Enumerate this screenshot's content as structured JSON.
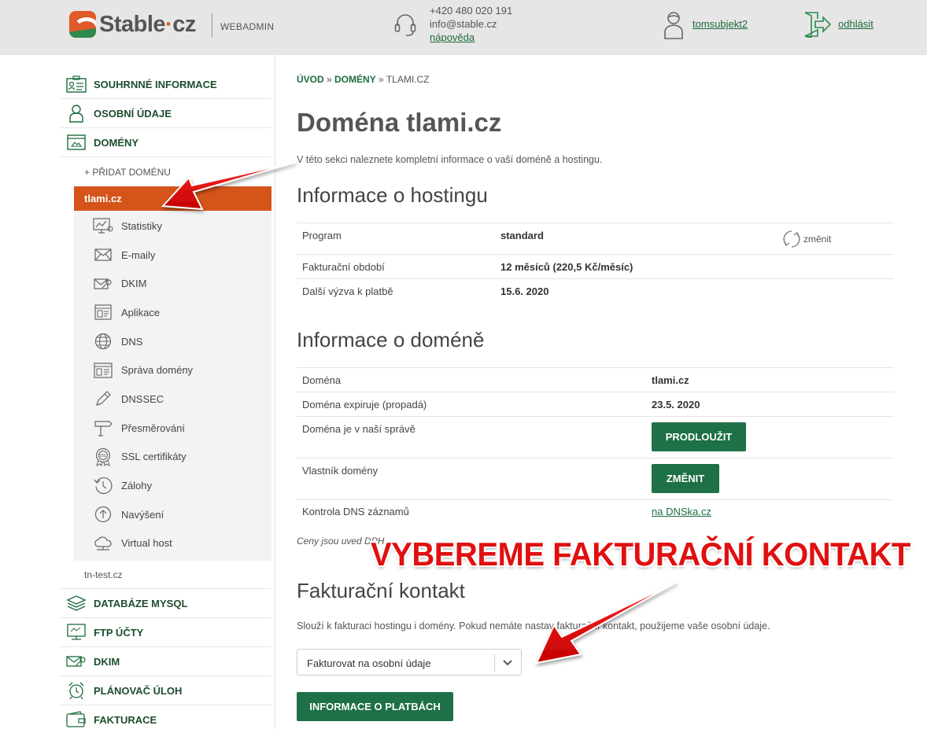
{
  "header": {
    "logo_text_main": "Stable",
    "logo_text_dot": "·",
    "logo_text_tld": "cz",
    "section": "WEBADMIN",
    "phone": "+420 480 020 191",
    "email": "info@stable.cz",
    "help": "nápověda",
    "username": "tomsubjekt2",
    "logout": "odhlásit"
  },
  "sidebar": {
    "top_items": [
      {
        "label": "SOUHRNNÉ INFORMACE",
        "icon": "summary-card-icon"
      },
      {
        "label": "OSOBNÍ ÚDAJE",
        "icon": "person-icon"
      },
      {
        "label": "DOMÉNY",
        "icon": "browser-window-icon"
      }
    ],
    "add_domain": "+ PŘIDAT DOMÉNU",
    "active_domain": "tlami.cz",
    "sub_items": [
      {
        "label": "Statistiky",
        "icon": "statistics-icon"
      },
      {
        "label": "E-maily",
        "icon": "envelope-icon"
      },
      {
        "label": "DKIM",
        "icon": "key-envelope-icon"
      },
      {
        "label": "Aplikace",
        "icon": "app-window-icon"
      },
      {
        "label": "DNS",
        "icon": "globe-icon"
      },
      {
        "label": "Správa domény",
        "icon": "domain-window-icon"
      },
      {
        "label": "DNSSEC",
        "icon": "pen-icon"
      },
      {
        "label": "Přesměrování",
        "icon": "signpost-icon"
      },
      {
        "label": "SSL certifikáty",
        "icon": "ssl-badge-icon"
      },
      {
        "label": "Zálohy",
        "icon": "backup-clock-icon"
      },
      {
        "label": "Navýšení",
        "icon": "arrow-up-circle-icon"
      },
      {
        "label": "Virtual host",
        "icon": "cloud-icon"
      }
    ],
    "other_domain": "tn-test.cz",
    "bottom_items": [
      {
        "label": "DATABÁZE MYSQL",
        "icon": "database-icon"
      },
      {
        "label": "FTP ÚČTY",
        "icon": "ftp-monitor-icon"
      },
      {
        "label": "DKIM",
        "icon": "key-envelope-icon"
      },
      {
        "label": "PLÁNOVAČ ÚLOH",
        "icon": "alarm-clock-icon"
      },
      {
        "label": "FAKTURACE",
        "icon": "wallet-icon"
      }
    ]
  },
  "breadcrumb": {
    "home": "ÚVOD",
    "sep1": " » ",
    "domains": "DOMÉNY",
    "sep2": " » ",
    "current": "TLAMI.CZ"
  },
  "page": {
    "title": "Doména tlami.cz",
    "intro": "V této sekci naleznete kompletní informace o vaší doméně a hostingu."
  },
  "hosting": {
    "heading": "Informace o hostingu",
    "rows": [
      {
        "label": "Program",
        "value": "standard"
      },
      {
        "label": "Fakturační období",
        "value": "12 měsíců (220,5 Kč/měsíc)"
      },
      {
        "label": "Další výzva k platbě",
        "value": "15.6. 2020"
      }
    ],
    "change_label": "změnit"
  },
  "domain_info": {
    "heading": "Informace o doméně",
    "rows": [
      {
        "label": "Doména",
        "value": "tlami.cz"
      },
      {
        "label": "Doména expiruje (propadá)",
        "value": "23.5. 2020"
      },
      {
        "label": "Doména je v naší správě",
        "button": "PRODLOUŽIT"
      },
      {
        "label": "Vlastník domény",
        "button": "ZMĚNIT"
      },
      {
        "label": "Kontrola DNS záznamů",
        "link": "na DNSka.cz"
      }
    ],
    "prices_note": "Ceny jsou uved         DPH."
  },
  "billing": {
    "heading": "Fakturační kontakt",
    "description": "Slouží k fakturaci hostingu i domény. Pokud nemáte nastav       fakturační kontakt, použijeme vaše osobní údaje.",
    "select_value": "Fakturovat na osobní údaje",
    "payments_button": "INFORMACE O PLATBÁCH"
  },
  "annotation": {
    "text": "VYBEREME FAKTURAČNÍ KONTAKT"
  },
  "colors": {
    "brand_green": "#1e7046",
    "active_orange": "#d4541a",
    "annotation_red": "#e01010",
    "header_bg": "#e6e6e6"
  }
}
